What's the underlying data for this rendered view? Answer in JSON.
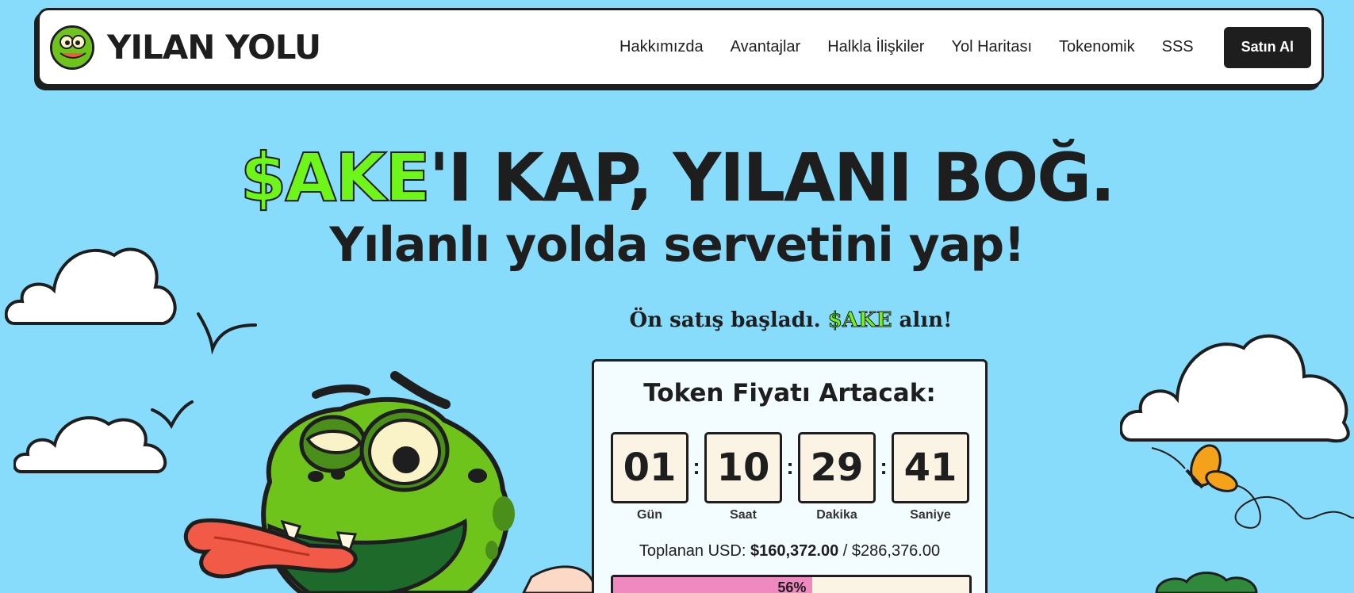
{
  "navbar": {
    "brand": "YILAN YOLU",
    "links": [
      "Hakkımızda",
      "Avantajlar",
      "Halkla İlişkiler",
      "Yol Haritası",
      "Tokenomik",
      "SSS"
    ],
    "buy_label": "Satın Al"
  },
  "hero": {
    "headline_accent": "$AKE",
    "headline_rest": "'I KAP, YILANI BOĞ.",
    "subheadline": "Yılanlı yolda servetini yap!",
    "presale_prefix": "Ön satış başladı.",
    "presale_token": "$AKE",
    "presale_suffix": "alın!"
  },
  "presale_card": {
    "title": "Token Fiyatı Artacak:",
    "countdown": [
      {
        "value": "01",
        "label": "Gün"
      },
      {
        "value": "10",
        "label": "Saat"
      },
      {
        "value": "29",
        "label": "Dakika"
      },
      {
        "value": "41",
        "label": "Saniye"
      }
    ],
    "raised_prefix": "Toplanan USD:",
    "raised_amount": "$160,372.00",
    "raised_separator": "/",
    "raised_target": "$286,376.00",
    "progress_percent": 56,
    "progress_label": "56%"
  },
  "colors": {
    "background": "#87dcfb",
    "accent_green": "#6ef51a",
    "dark": "#1e1e1e",
    "progress_pink": "#f089c0",
    "cream": "#fbf3e4"
  }
}
